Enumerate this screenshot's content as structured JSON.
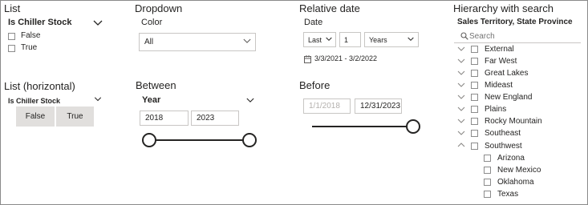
{
  "list": {
    "title": "List",
    "field": "Is Chiller Stock",
    "items": [
      "False",
      "True"
    ]
  },
  "list_horizontal": {
    "title": "List (horizontal)",
    "field": "Is Chiller Stock",
    "buttons": [
      "False",
      "True"
    ]
  },
  "dropdown": {
    "title": "Dropdown",
    "field": "Color",
    "value": "All"
  },
  "between": {
    "title": "Between",
    "field": "Year",
    "from": "2018",
    "to": "2023"
  },
  "relative_date": {
    "title": "Relative date",
    "field": "Date",
    "mode": "Last",
    "count": "1",
    "unit": "Years",
    "range": "3/3/2021 - 3/2/2022"
  },
  "before": {
    "title": "Before",
    "from_placeholder": "1/1/2018",
    "to": "12/31/2023"
  },
  "hierarchy": {
    "title": "Hierarchy with search",
    "field": "Sales Territory, State Province",
    "search_placeholder": "Search",
    "territories": [
      "External",
      "Far West",
      "Great Lakes",
      "Mideast",
      "New England",
      "Plains",
      "Rocky Mountain",
      "Southeast",
      "Southwest"
    ],
    "states": [
      "Arizona",
      "New Mexico",
      "Oklahoma",
      "Texas"
    ]
  },
  "colors": {
    "text": "#252423",
    "border": "#c8c6c4",
    "button_bg": "#e1dfdd",
    "frame": "#8a8a8a"
  }
}
